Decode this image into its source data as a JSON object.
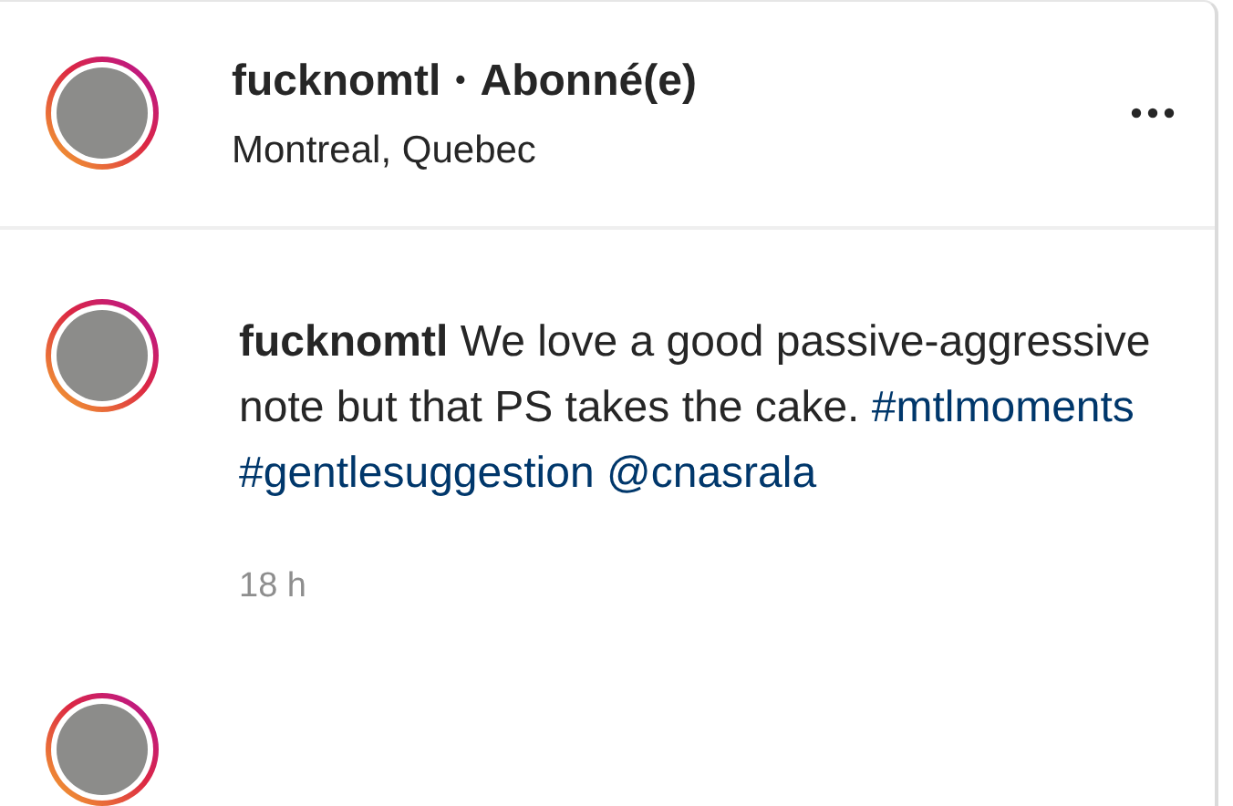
{
  "header": {
    "username": "fucknomtl",
    "separator": "•",
    "follow_status": "Abonné(e)",
    "location": "Montreal, Quebec"
  },
  "caption": {
    "parts": [
      {
        "kind": "username",
        "text": "fucknomtl"
      },
      {
        "kind": "text",
        "text": "We love a good passive-aggressive note but that PS takes the cake."
      },
      {
        "kind": "hashtag",
        "text": "#mtlmoments"
      },
      {
        "kind": "hashtag",
        "text": "#gentlesuggestion"
      },
      {
        "kind": "mention",
        "text": "@cnasrala"
      }
    ],
    "time": "18 h"
  }
}
